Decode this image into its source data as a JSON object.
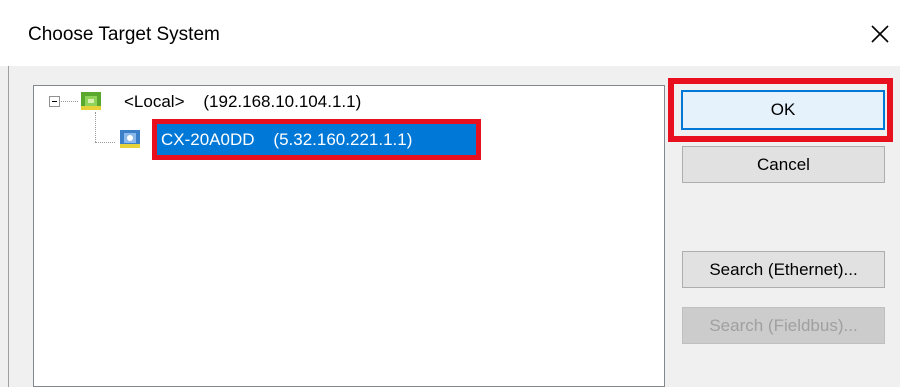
{
  "dialog": {
    "title": "Choose Target System",
    "close_icon": "close-icon"
  },
  "tree": {
    "root": {
      "label": "<Local>    (192.168.10.104.1.1)",
      "expanded": true,
      "icon": "local-system-icon"
    },
    "child": {
      "label": "CX-20A0DD    (5.32.160.221.1.1)",
      "selected": true,
      "icon": "target-device-icon"
    }
  },
  "buttons": {
    "ok": "OK",
    "cancel": "Cancel",
    "search_ethernet": "Search (Ethernet)...",
    "search_fieldbus": "Search (Fieldbus)..."
  },
  "colors": {
    "selection": "#0078d7",
    "highlight_frame": "#e8101e"
  }
}
